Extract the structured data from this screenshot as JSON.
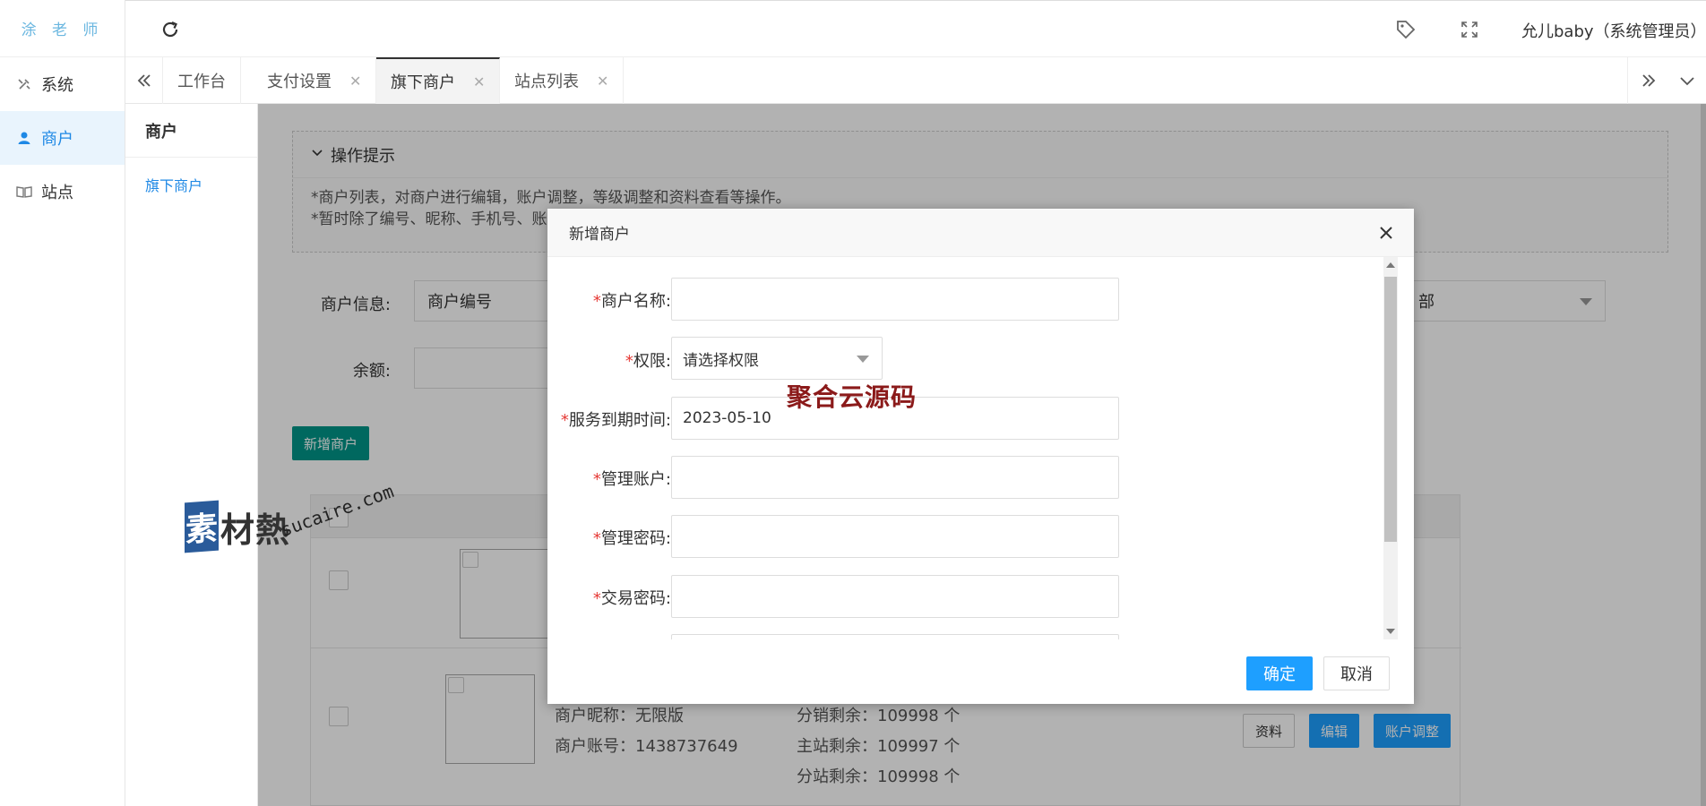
{
  "sidebar": {
    "logo_text": "涂 老 师",
    "items": [
      {
        "label": "系统",
        "icon": "tools-icon"
      },
      {
        "label": "商户",
        "icon": "user-icon"
      },
      {
        "label": "站点",
        "icon": "book-icon"
      }
    ]
  },
  "header": {
    "user": "允儿baby（系统管理员）"
  },
  "tabs": [
    {
      "label": "工作台"
    },
    {
      "label": "支付设置"
    },
    {
      "label": "旗下商户"
    },
    {
      "label": "站点列表"
    }
  ],
  "subnav": {
    "title": "商户",
    "item": "旗下商户"
  },
  "tips": {
    "title": "操作提示",
    "line1": "*商户列表，对商户进行编辑，账户调整，等级调整和资料查看等操作。",
    "line2": "*暂时除了编号、昵称、手机号、账"
  },
  "search": {
    "info_label": "商户信息:",
    "info_value": "商户编号",
    "balance_label": "余额:",
    "right_value": "部"
  },
  "add_button": "新增商户",
  "table": {
    "row2": {
      "nickname": "商户昵称：无限版",
      "account": "商户账号：1438737649",
      "stat1": "分销剩余：109998 个",
      "stat2": "主站剩余：109997 个",
      "stat3": "分站剩余：109998 个",
      "btn_info": "资料",
      "btn_edit": "编辑",
      "btn_adjust": "账户调整"
    }
  },
  "modal": {
    "title": "新增商户",
    "fields": [
      {
        "label": "商户名称:",
        "value": ""
      },
      {
        "label": "权限:",
        "value": "请选择权限"
      },
      {
        "label": "服务到期时间:",
        "value": "2023-05-10"
      },
      {
        "label": "管理账户:",
        "value": ""
      },
      {
        "label": "管理密码:",
        "value": ""
      },
      {
        "label": "交易密码:",
        "value": ""
      }
    ],
    "required_mark": "*",
    "ok": "确定",
    "cancel": "取消"
  },
  "watermarks": {
    "sucai_cn": "素",
    "sucai_cn_rest": "材熱",
    "sucai_url": "sucaire.com",
    "juhe": "聚合云源码"
  },
  "colors": {
    "accent_blue": "#1e9fff",
    "teal": "#009688",
    "green_text": "#2e9e3a"
  }
}
